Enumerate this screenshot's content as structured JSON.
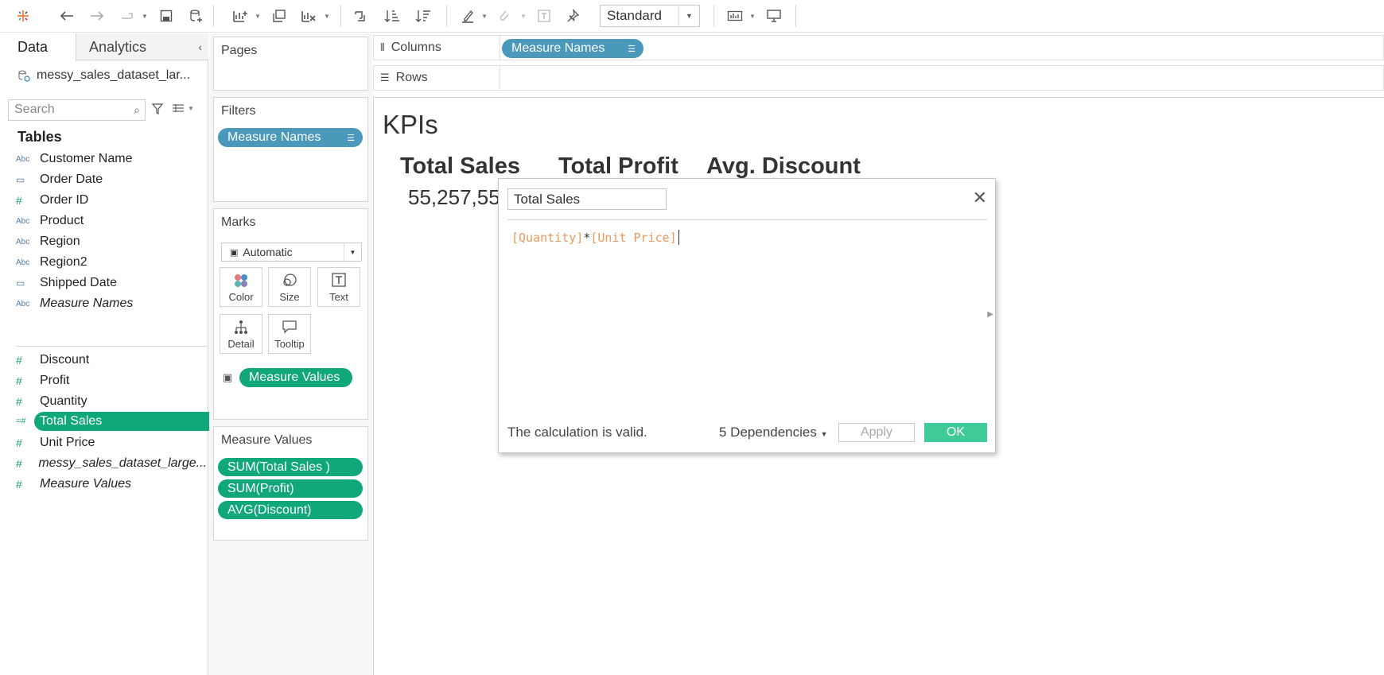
{
  "toolbar": {
    "view_mode": "Standard"
  },
  "datapane": {
    "tab_data": "Data",
    "tab_analytics": "Analytics",
    "source_name": "messy_sales_dataset_lar...",
    "search_placeholder": "Search",
    "tables_heading": "Tables",
    "fields": [
      {
        "label": "Customer Name",
        "type": "Abc"
      },
      {
        "label": "Order Date",
        "type": "date"
      },
      {
        "label": "Order ID",
        "type": "#"
      },
      {
        "label": "Product",
        "type": "Abc"
      },
      {
        "label": "Region",
        "type": "Abc"
      },
      {
        "label": "Region2",
        "type": "Abc"
      },
      {
        "label": "Shipped Date",
        "type": "date"
      },
      {
        "label": "Measure Names",
        "type": "Abc"
      },
      {
        "label": "Discount",
        "type": "#"
      },
      {
        "label": "Profit",
        "type": "#"
      },
      {
        "label": "Quantity",
        "type": "#"
      },
      {
        "label": "Total Sales",
        "type": "calc#"
      },
      {
        "label": "Unit Price",
        "type": "#"
      },
      {
        "label": "messy_sales_dataset_large...",
        "type": "#"
      },
      {
        "label": "Measure Values",
        "type": "#"
      }
    ],
    "type_icons": {
      "Abc": "Abc",
      "date": "▢",
      "#": "#",
      "calc#": "=#"
    }
  },
  "shelves": {
    "pages_title": "Pages",
    "filters_title": "Filters",
    "filter_pill": "Measure Names",
    "marks_title": "Marks",
    "mark_type": "Automatic",
    "mark_buttons": {
      "color": "Color",
      "size": "Size",
      "text": "Text",
      "detail": "Detail",
      "tooltip": "Tooltip"
    },
    "text_pill": "Measure Values",
    "measure_values_title": "Measure Values",
    "measure_pills": [
      "SUM(Total Sales )",
      "SUM(Profit)",
      "AVG(Discount)"
    ],
    "columns_label": "Columns",
    "columns_pill": "Measure Names",
    "rows_label": "Rows"
  },
  "view": {
    "title": "KPIs",
    "kpi_headers": [
      "Total Sales",
      "Total Profit",
      "Avg. Discount"
    ],
    "kpi_value_visible": "55,257,55"
  },
  "calc_dialog": {
    "name": "Total Sales",
    "formula_field1": "[Quantity]",
    "formula_op": "*",
    "formula_field2": "[Unit Price]",
    "status": "The calculation is valid.",
    "dependencies": "5 Dependencies",
    "apply_label": "Apply",
    "ok_label": "OK"
  },
  "colors": {
    "pill_blue": "#4a98ba",
    "pill_green": "#10a77a",
    "ok_button": "#3ecb98",
    "formula_field": "#e79a5e"
  }
}
